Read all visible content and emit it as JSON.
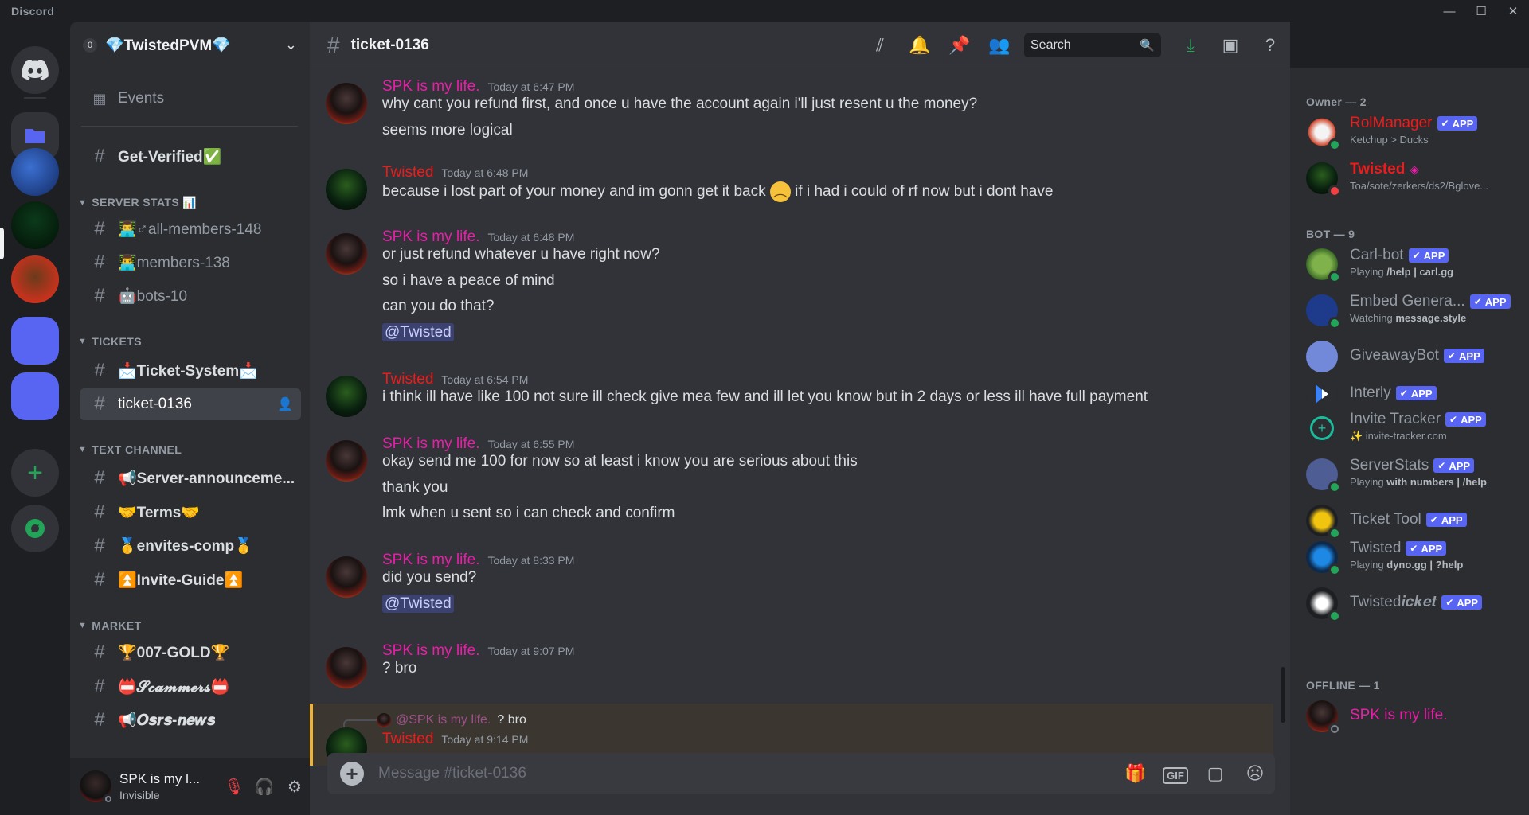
{
  "window": {
    "title": "Discord",
    "controls": [
      "—",
      "☐",
      "✕"
    ]
  },
  "guild": {
    "badge": "0",
    "name": "💎TwistedPVM💎"
  },
  "sidebar": {
    "events": "Events",
    "get_verified": "Get-Verified✅",
    "categories": {
      "server_stats": "SERVER STATS 📊",
      "tickets": "TICKETS",
      "text_channel": "TEXT CHANNEL",
      "market": "MARKET"
    },
    "channels": {
      "all_members": "👨‍💻♂all-members-148",
      "members": "👨‍💻members-138",
      "bots": "🤖bots-10",
      "ticket_system": "📩Ticket-System📩",
      "ticket_0136": "ticket-0136",
      "announcements": "📢Server-announceme...",
      "terms": "🤝Terms🤝",
      "envites": "🥇envites-comp🥇",
      "invite_guide": "⏫Invite-Guide⏫",
      "gold": "🏆007-GOLD🏆",
      "scammers": "📛𝓢𝓬𝓪𝓶𝓶𝓮𝓻𝓼📛",
      "osrs_news": "📢𝑶𝒔𝒓𝒔-𝒏𝒆𝒘𝒔"
    }
  },
  "user_panel": {
    "name": "SPK is my l...",
    "status": "Invisible"
  },
  "channel": {
    "name": "ticket-0136",
    "search_placeholder": "Search"
  },
  "messages": [
    {
      "author": "SPK is my life.",
      "time": "Today at 6:47 PM",
      "lines": [
        "why cant you refund first, and once u have the account again i'll just resent u the money?",
        "seems more logical"
      ]
    },
    {
      "author": "Twisted",
      "time": "Today at 6:48 PM",
      "line_a": "because i lost part of your  money and im gonn get it back",
      "line_b": "if i had i could of rf now but i dont have"
    },
    {
      "author": "SPK is my life.",
      "time": "Today at 6:48 PM",
      "lines": [
        "or just refund whatever u have right now?",
        "so i have a peace of mind",
        "can you do that?"
      ],
      "mention": "@Twisted"
    },
    {
      "author": "Twisted",
      "time": "Today at 6:54 PM",
      "lines": [
        "i think ill have like 100 not sure ill check give mea few and ill let you know but in 2 days or less ill have full payment"
      ]
    },
    {
      "author": "SPK is my life.",
      "time": "Today at 6:55 PM",
      "lines": [
        "okay send me 100 for now so at least i know you are serious about this",
        "thank you",
        "lmk when u sent so i can check and confirm"
      ]
    },
    {
      "author": "SPK is my life.",
      "time": "Today at 8:33 PM",
      "lines": [
        "did you send?"
      ],
      "mention": "@Twisted"
    },
    {
      "author": "SPK is my life.",
      "time": "Today at 9:07 PM",
      "lines": [
        "? bro"
      ]
    },
    {
      "author": "Twisted",
      "time": "Today at 9:14 PM",
      "reply_to": "@SPK is my life.",
      "reply_text": "? bro"
    }
  ],
  "composer": {
    "placeholder": "Message #ticket-0136"
  },
  "members": {
    "owner_header": "Owner — 2",
    "bot_header": "BOT — 9",
    "offline_header": "OFFLINE — 1",
    "app_label": "APP",
    "owners": [
      {
        "name": "RolManager",
        "sub": "Ketchup > Ducks",
        "app": true
      },
      {
        "name": "Twisted",
        "sub": "Toa/sote/zerkers/ds2/Bglove..."
      }
    ],
    "bots": [
      {
        "name": "Carl-bot",
        "sub_pre": "Playing ",
        "sub_bold": "/help | carl.gg"
      },
      {
        "name": "Embed Genera...",
        "sub_pre": "Watching ",
        "sub_bold": "message.style"
      },
      {
        "name": "GiveawayBot"
      },
      {
        "name": "Interly"
      },
      {
        "name": "Invite Tracker",
        "sub_pre": "✨ invite-tracker.com"
      },
      {
        "name": "ServerStats",
        "sub_pre": "Playing ",
        "sub_bold": "with numbers | /help"
      },
      {
        "name": "Ticket Tool"
      },
      {
        "name": "Twisted",
        "sub_pre": "Playing ",
        "sub_bold": "dyno.gg | ?help"
      },
      {
        "name": "Twisted𝒊𝒄𝒌𝒆𝒕"
      }
    ],
    "offline": [
      {
        "name": "SPK is my life."
      }
    ]
  },
  "colors": {
    "spk": "#e91ea8",
    "twisted": "#ed1c1c",
    "accent": "#5865f2",
    "online": "#23a559"
  }
}
